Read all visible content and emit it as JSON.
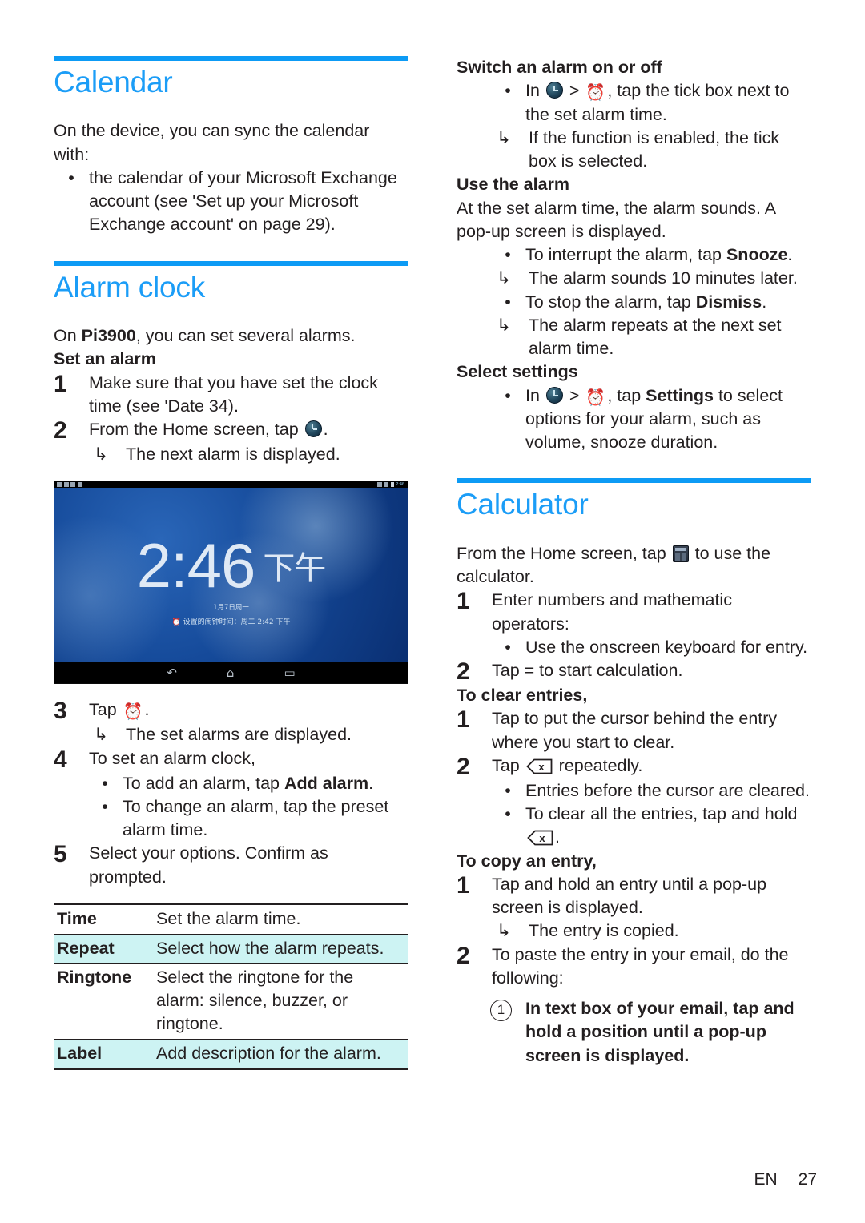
{
  "page": {
    "language": "EN",
    "number": "27"
  },
  "left": {
    "calendar": {
      "title": "Calendar",
      "intro": "On the device, you can sync the calendar with:",
      "bullet1": "the calendar of your Microsoft Exchange account (see 'Set up your Microsoft Exchange account' on page 29)."
    },
    "alarm": {
      "title": "Alarm clock",
      "intro_pre": "On ",
      "intro_bold": "Pi3900",
      "intro_post": ", you can set several alarms.",
      "set_heading": "Set an alarm",
      "step1_num": "1",
      "step1_text": "Make sure that you have set the clock time (see 'Date 34).",
      "step2_num": "2",
      "step2_pre": "From the Home screen, tap ",
      "step2_post": ".",
      "step2_result_mark": "↳",
      "step2_result": "The next alarm is displayed.",
      "step3_num": "3",
      "step3_pre": "Tap ",
      "step3_post": ".",
      "step3_result_mark": "↳",
      "step3_result": "The set alarms are displayed.",
      "step4_num": "4",
      "step4_text": "To set an alarm clock,",
      "step4_b1_pre": "To add an alarm, tap ",
      "step4_b1_bold": "Add alarm",
      "step4_b1_post": ".",
      "step4_b2": " To change an alarm, tap the preset alarm time.",
      "step5_num": "5",
      "step5_text": "Select your options. Confirm as prompted.",
      "bullet_mark": "•"
    },
    "screenshot": {
      "name": "alarm-clock-tablet-screenshot",
      "time": "2:46",
      "ampm": "下午",
      "date": "1月7日周一",
      "alarm_line": "⏰ 设置的闹钟时间：周二 2:42 下午",
      "status_time": "2:46",
      "nav_back": "↶",
      "nav_home": "⌂",
      "nav_recent": "▭"
    },
    "table": {
      "rows": [
        {
          "key": "Time",
          "value": "Set the alarm time.",
          "highlight": false
        },
        {
          "key": "Repeat",
          "value": "Select how the alarm repeats.",
          "highlight": true
        },
        {
          "key": "Ringtone",
          "value": "Select the ringtone for the alarm: silence, buzzer, or ringtone.",
          "highlight": false
        },
        {
          "key": "Label",
          "value": "Add description for the alarm.",
          "highlight": true
        }
      ]
    }
  },
  "right": {
    "switch_alarm": {
      "heading": "Switch an alarm on or off",
      "bullet_mark": "•",
      "b1_pre": "In ",
      "b1_mid": " > ",
      "b1_post": ", tap the tick box next to the set alarm time.",
      "result_mark": "↳",
      "result": "If the function is enabled, the tick box is selected."
    },
    "use_alarm": {
      "heading": "Use the alarm",
      "intro": "At the set alarm time, the alarm sounds. A pop-up screen is displayed.",
      "b1_pre": "To interrupt the alarm, tap ",
      "b1_bold": "Snooze",
      "b1_post": ".",
      "r1_mark": "↳",
      "r1": "The alarm sounds 10 minutes later.",
      "b2_pre": "To stop the alarm, tap ",
      "b2_bold": "Dismiss",
      "b2_post": ".",
      "r2_mark": "↳",
      "r2": "The alarm repeats at the next set alarm time."
    },
    "select_settings": {
      "heading": "Select settings",
      "b1_pre": "In ",
      "b1_mid": " > ",
      "b1_post_pre": ", tap ",
      "b1_bold": "Settings",
      "b1_post": " to select options for your alarm, such as volume, snooze duration."
    },
    "calculator": {
      "title": "Calculator",
      "intro_pre": "From the Home screen, tap ",
      "intro_post": " to use the calculator.",
      "step1_num": "1",
      "step1_text": "Enter numbers and mathematic operators:",
      "step1_b1": "Use the onscreen keyboard for entry.",
      "step2_num": "2",
      "step2_text": "Tap = to start calculation.",
      "clear_heading": "To clear entries,",
      "clear1_num": "1",
      "clear1_text": "Tap to put the cursor behind the entry where you start to clear.",
      "clear2_num": "2",
      "clear2_pre": "Tap ",
      "clear2_post": " repeatedly.",
      "clear2_b1": "Entries before the cursor are cleared.",
      "clear2_b2_pre": "To clear all the entries, tap and hold ",
      "clear2_b2_post": ".",
      "copy_heading": "To copy an entry,",
      "copy1_num": "1",
      "copy1_text": "Tap and hold an entry until a pop-up screen is displayed.",
      "copy1_r_mark": "↳",
      "copy1_r": "The entry is copied.",
      "copy2_num": "2",
      "copy2_text": "To paste the entry in your email, do the following:",
      "copy2_c1_num": "1",
      "copy2_c1_text": "In text box of your email, tap and hold a position until a pop-up screen is displayed."
    }
  },
  "colors": {
    "accent_blue": "#1b9df7",
    "rule_blue": "#0d9bf5",
    "table_highlight": "#cdf3f3",
    "text": "#231f20"
  }
}
